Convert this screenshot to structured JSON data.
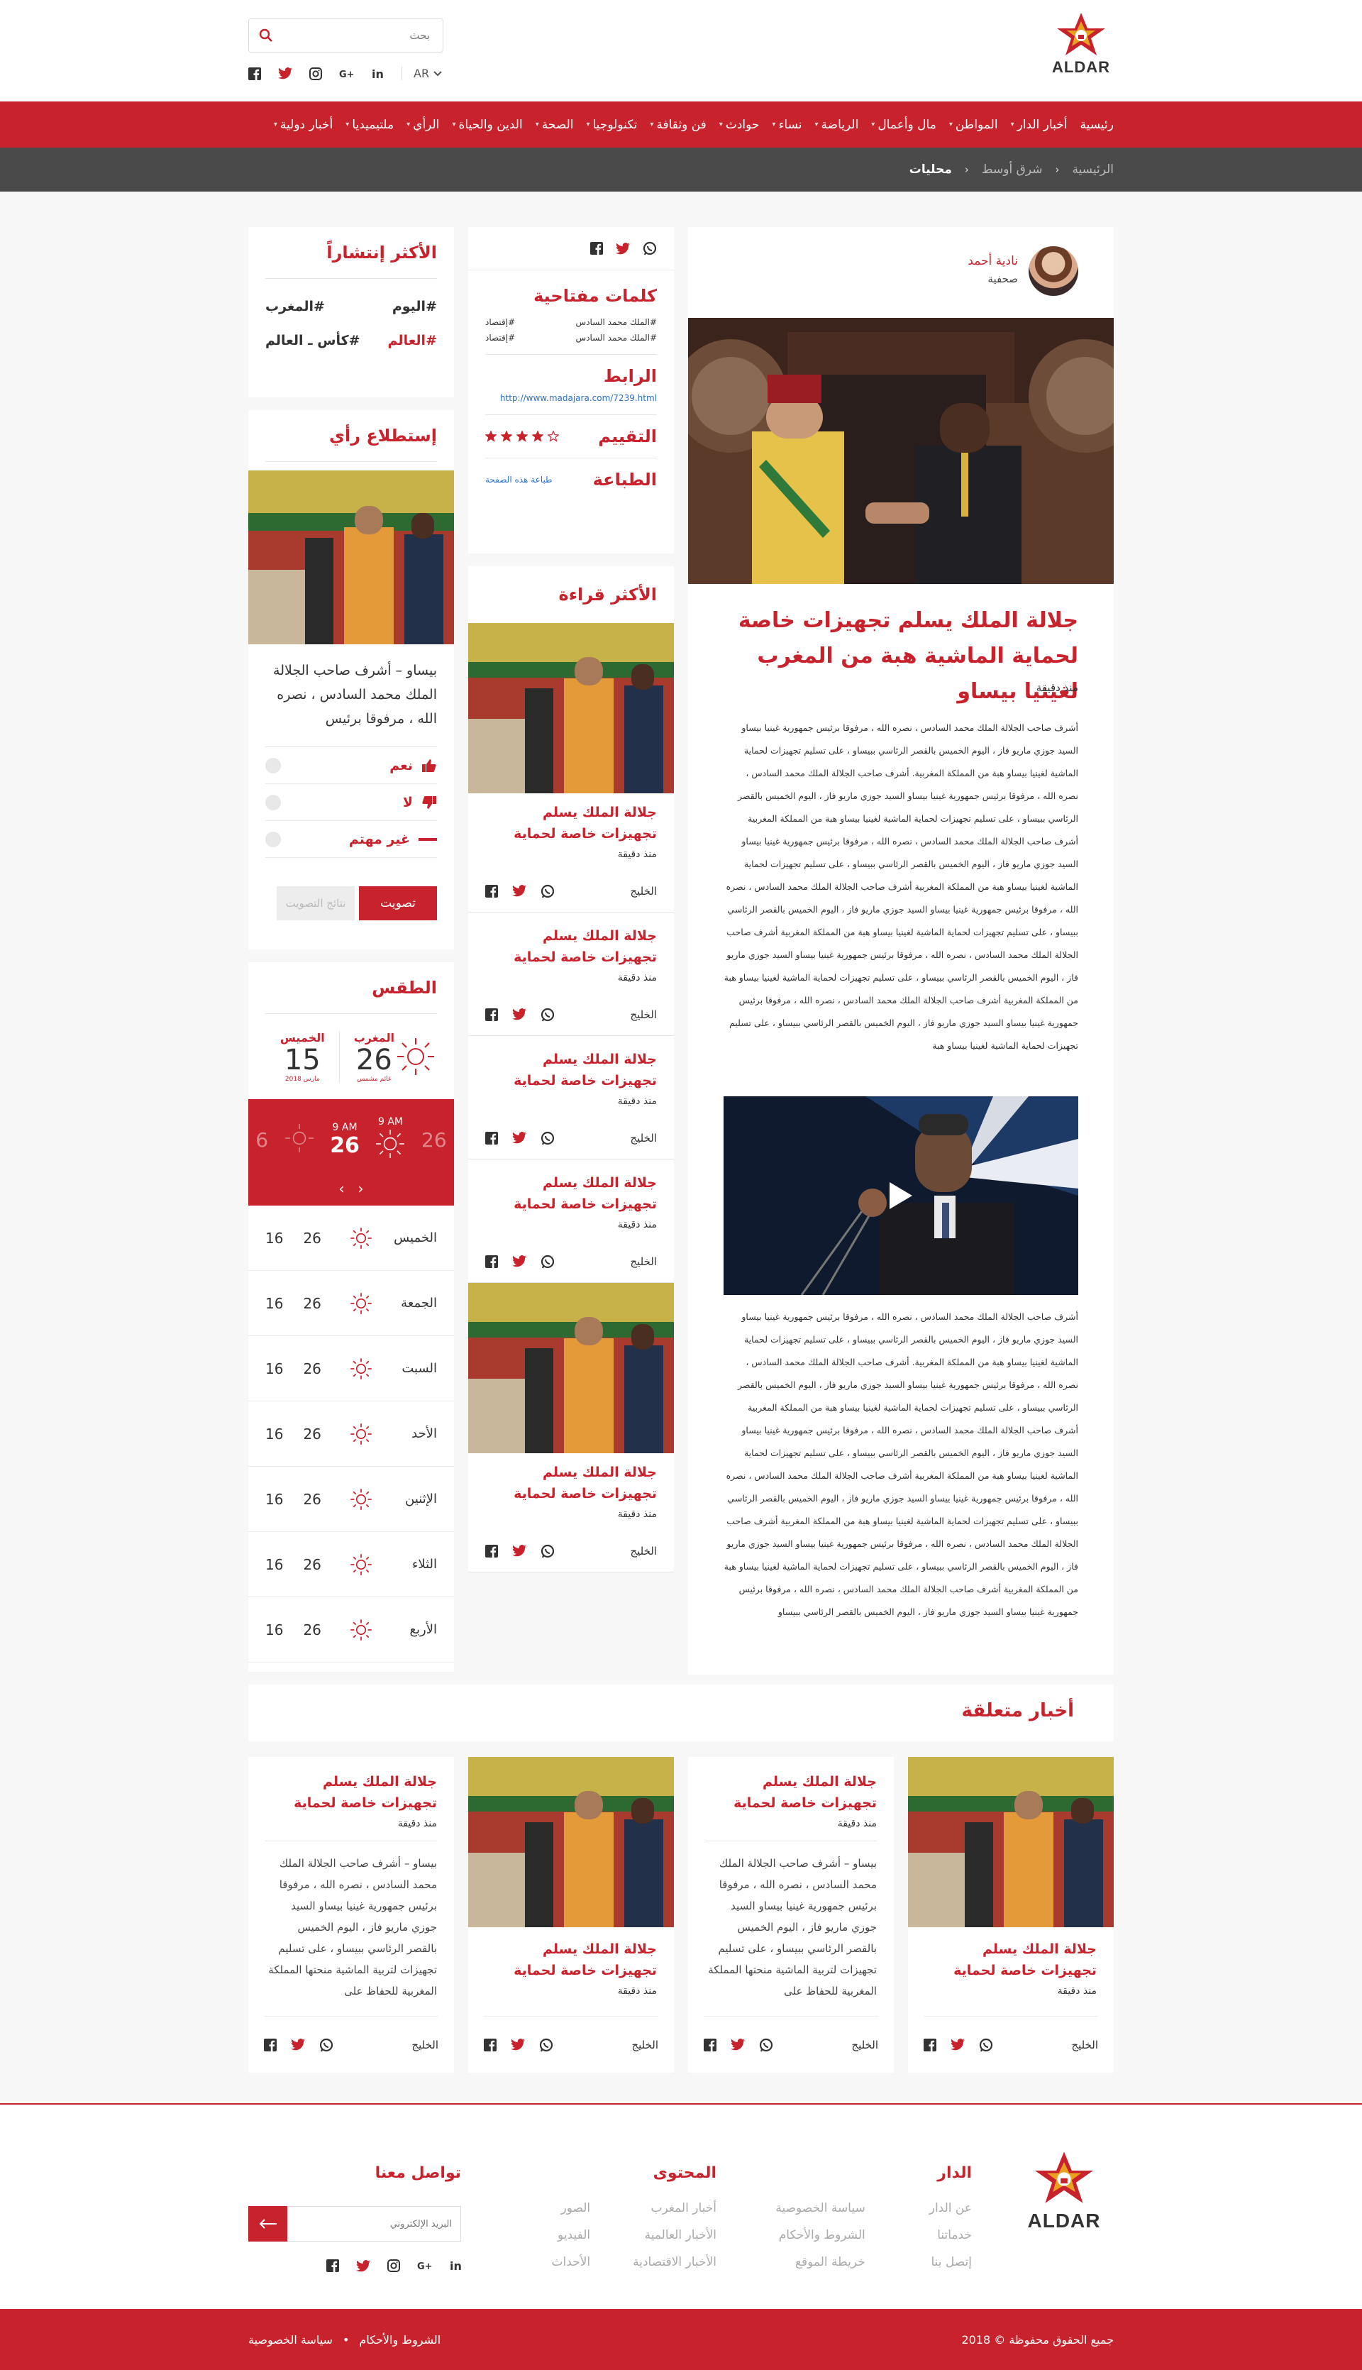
{
  "header": {
    "logo_text": "ALDAR",
    "search_placeholder": "بحث",
    "lang": "AR",
    "brand_color": "#c8232c"
  },
  "nav": {
    "items": [
      {
        "label": "رئيسية",
        "caret": false
      },
      {
        "label": "أخبار الدار",
        "caret": true
      },
      {
        "label": "المواطن",
        "caret": true
      },
      {
        "label": "مال وأعمال",
        "caret": true
      },
      {
        "label": "الرياضة",
        "caret": true
      },
      {
        "label": "نساء",
        "caret": true
      },
      {
        "label": "حوادث",
        "caret": true
      },
      {
        "label": "فن وثقافة",
        "caret": true
      },
      {
        "label": "تكنولوجيا",
        "caret": true
      },
      {
        "label": "الصحة",
        "caret": true
      },
      {
        "label": "الدين والحياة",
        "caret": true
      },
      {
        "label": "الرأي",
        "caret": true
      },
      {
        "label": "ملتيميديا",
        "caret": true
      },
      {
        "label": "أخبار دولية",
        "caret": true
      }
    ]
  },
  "breadcrumb": {
    "home": "الرئيسية",
    "section": "شرق أوسط",
    "current": "محليات"
  },
  "article": {
    "author_name": "نادية أحمد",
    "author_role": "صحفية",
    "title": "جلالة الملك يسلم تجهيزات خاصة لحماية الماشية هبة من المغرب لغينيا بيساو",
    "time": "منذ دقيقة",
    "body_1": "أشرف صاحب الجلالة الملك محمد السادس ، نصره الله ، مرفوقا برئيس جمهورية غينيا بيساو السيد جوزي ماريو فاز ، اليوم الخميس بالقصر الرئاسي ببيساو ، على تسليم تجهيزات لحماية الماشية لغينيا بيساو هبة من المملكة المغربية. أشرف صاحب الجلالة الملك محمد السادس ، نصره الله ، مرفوقا برئيس جمهورية غينيا بيساو السيد جوزي ماريو فاز ، اليوم الخميس بالقصر الرئاسي ببيساو ، على تسليم تجهيزات لحماية الماشية لغينيا بيساو هبة من المملكة المغربية أشرف صاحب الجلالة الملك محمد السادس ، نصره الله ، مرفوقا برئيس جمهورية غينيا بيساو السيد جوزي ماريو فاز ، اليوم الخميس بالقصر الرئاسي ببيساو ، على تسليم تجهيزات لحماية الماشية لغينيا بيساو هبة من المملكة المغربية أشرف صاحب الجلالة الملك محمد السادس ، نصره الله ، مرفوقا برئيس جمهورية غينيا بيساو السيد جوزي ماريو فاز ، اليوم الخميس بالقصر الرئاسي ببيساو ، على تسليم تجهيزات لحماية الماشية لغينيا بيساو هبة من المملكة المغربية أشرف صاحب الجلالة الملك محمد السادس ، نصره الله ، مرفوقا برئيس جمهورية غينيا بيساو السيد جوزي ماريو فاز ، اليوم الخميس بالقصر الرئاسي ببيساو ، على تسليم تجهيزات لحماية الماشية لغينيا بيساو هبة من المملكة المغربية أشرف صاحب الجلالة الملك محمد السادس ، نصره الله ، مرفوقا برئيس جمهورية غينيا بيساو السيد جوزي ماريو فاز ، اليوم الخميس بالقصر الرئاسي ببيساو ، على تسليم تجهيزات لحماية الماشية لغينيا بيساو هبة",
    "body_2": "أشرف صاحب الجلالة الملك محمد السادس ، نصره الله ، مرفوقا برئيس جمهورية غينيا بيساو السيد جوزي ماريو فاز ، اليوم الخميس بالقصر الرئاسي ببيساو ، على تسليم تجهيزات لحماية الماشية لغينيا بيساو هبة من المملكة المغربية. أشرف صاحب الجلالة الملك محمد السادس ، نصره الله ، مرفوقا برئيس جمهورية غينيا بيساو السيد جوزي ماريو فاز ، اليوم الخميس بالقصر الرئاسي ببيساو ، على تسليم تجهيزات لحماية الماشية لغينيا بيساو هبة من المملكة المغربية أشرف صاحب الجلالة الملك محمد السادس ، نصره الله ، مرفوقا برئيس جمهورية غينيا بيساو السيد جوزي ماريو فاز ، اليوم الخميس بالقصر الرئاسي ببيساو ، على تسليم تجهيزات لحماية الماشية لغينيا بيساو هبة من المملكة المغربية أشرف صاحب الجلالة الملك محمد السادس ، نصره الله ، مرفوقا برئيس جمهورية غينيا بيساو السيد جوزي ماريو فاز ، اليوم الخميس بالقصر الرئاسي ببيساو ، على تسليم تجهيزات لحماية الماشية لغينيا بيساو هبة من المملكة المغربية أشرف صاحب الجلالة الملك محمد السادس ، نصره الله ، مرفوقا برئيس جمهورية غينيا بيساو السيد جوزي ماريو فاز ، اليوم الخميس بالقصر الرئاسي ببيساو ، على تسليم تجهيزات لحماية الماشية لغينيا بيساو هبة من المملكة المغربية أشرف صاحب الجلالة الملك محمد السادس ، نصره الله ، مرفوقا برئيس جمهورية غينيا بيساو السيد جوزي ماريو فاز ، اليوم الخميس بالقصر الرئاسي ببيساو"
  },
  "keywords": {
    "title": "كلمات مفتاحية",
    "tags": [
      "#الملك محمد السادس",
      "#إقتصاد",
      "#الملك محمد السادس",
      "#إقتصاد"
    ],
    "link_title": "الرابط",
    "link": "http://www.madajara.com/7239.html",
    "rating_title": "التقييم",
    "rating": 4,
    "rating_max": 5,
    "print_title": "الطباعة",
    "print_link": "طباعة هذه الصفحة"
  },
  "most_read": {
    "title": "الأكثر قراءة",
    "items": [
      {
        "title": "جلالة الملك يسلم تجهيزات خاصة لحماية",
        "time": "منذ دقيقة",
        "source": "الخليج",
        "image": true
      },
      {
        "title": "جلالة الملك يسلم تجهيزات خاصة لحماية",
        "time": "منذ دقيقة",
        "source": "الخليج",
        "image": false
      },
      {
        "title": "جلالة الملك يسلم تجهيزات خاصة لحماية",
        "time": "منذ دقيقة",
        "source": "الخليج",
        "image": false
      },
      {
        "title": "جلالة الملك يسلم تجهيزات خاصة لحماية",
        "time": "منذ دقيقة",
        "source": "الخليج",
        "image": false
      },
      {
        "title": "جلالة الملك يسلم تجهيزات خاصة لحماية",
        "time": "منذ دقيقة",
        "source": "الخليج",
        "image": true
      }
    ]
  },
  "trending": {
    "title": "الأكثر إنتشاراً",
    "tags": [
      [
        "#اليوم",
        "#المغرب"
      ],
      [
        "#العالم",
        "#كأس ـ العالم"
      ]
    ]
  },
  "poll": {
    "title": "إستطلاع رأي",
    "question": "بيساو – أشرف صاحب الجلالة الملك محمد السادس ، نصره الله ، مرفوقا برئيس",
    "options": [
      "نعم",
      "لا",
      "غير مهتم"
    ],
    "vote": "تصويت",
    "results": "نتائج التصويت"
  },
  "weather": {
    "title": "الطقس",
    "today": {
      "city": "المغرب",
      "temp": "26",
      "cond": "غائم مشمس"
    },
    "tomorrow": {
      "day": "الخميس",
      "temp": "15",
      "date": "مارس 2018"
    },
    "hourly": [
      {
        "time": "",
        "temp": "6"
      },
      {
        "time": "9 AM",
        "temp": "26"
      },
      {
        "time": "9 AM",
        "temp": "26"
      },
      {
        "time": "",
        "temp": "26"
      }
    ],
    "days": [
      {
        "day": "الخميس",
        "hi": "26",
        "lo": "16"
      },
      {
        "day": "الجمعة",
        "hi": "26",
        "lo": "16"
      },
      {
        "day": "السبت",
        "hi": "26",
        "lo": "16"
      },
      {
        "day": "الأحد",
        "hi": "26",
        "lo": "16"
      },
      {
        "day": "الإثنين",
        "hi": "26",
        "lo": "16"
      },
      {
        "day": "الثلاء",
        "hi": "26",
        "lo": "16"
      },
      {
        "day": "الأربع",
        "hi": "26",
        "lo": "16"
      }
    ]
  },
  "related": {
    "title": "أخبار متعلقة",
    "items": [
      {
        "title": "جلالة الملك يسلم تجهيزات خاصة لحماية",
        "time": "منذ دقيقة",
        "source": "الخليج",
        "excerpt": ""
      },
      {
        "title": "جلالة الملك يسلم تجهيزات خاصة لحماية",
        "time": "منذ دقيقة",
        "source": "الخليج",
        "excerpt": "بيساو – أشرف صاحب الجلالة الملك محمد السادس ، نصره الله ، مرفوقا برئيس جمهورية غينيا بيساو السيد جوزي ماريو فاز ، اليوم الخميس بالقصر الرئاسي ببيساو ، على تسليم تجهيزات لتربية الماشية منحتها المملكة المغربية للحفاظ على"
      },
      {
        "title": "جلالة الملك يسلم تجهيزات خاصة لحماية",
        "time": "منذ دقيقة",
        "source": "الخليج",
        "excerpt": ""
      },
      {
        "title": "جلالة الملك يسلم تجهيزات خاصة لحماية",
        "time": "منذ دقيقة",
        "source": "الخليج",
        "excerpt": "بيساو – أشرف صاحب الجلالة الملك محمد السادس ، نصره الله ، مرفوقا برئيس جمهورية غينيا بيساو السيد جوزي ماريو فاز ، اليوم الخميس بالقصر الرئاسي ببيساو ، على تسليم تجهيزات لتربية الماشية منحتها المملكة المغربية للحفاظ على"
      }
    ]
  },
  "footer": {
    "dar_title": "الدار",
    "dar_links": [
      "عن الدار",
      "خدماتنا",
      "إتصل بنا"
    ],
    "dar_links_2": [
      "سياسة الخصوصية",
      "الشروط والأحكام",
      "خريطة الموقع"
    ],
    "content_title": "المحتوى",
    "content_links": [
      "أخبار المغرب",
      "الأخبار العالمية",
      "الأخبار الاقتصادية"
    ],
    "content_links_2": [
      "الصور",
      "الفيديو",
      "الأحداث"
    ],
    "contact_title": "تواصل معنا",
    "email_placeholder": "البريد الإلكتروني",
    "copyright": "جميع الحقوق محفوظة © 2018",
    "privacy": "سياسة الخصوصية",
    "terms": "الشروط والأحكام"
  }
}
